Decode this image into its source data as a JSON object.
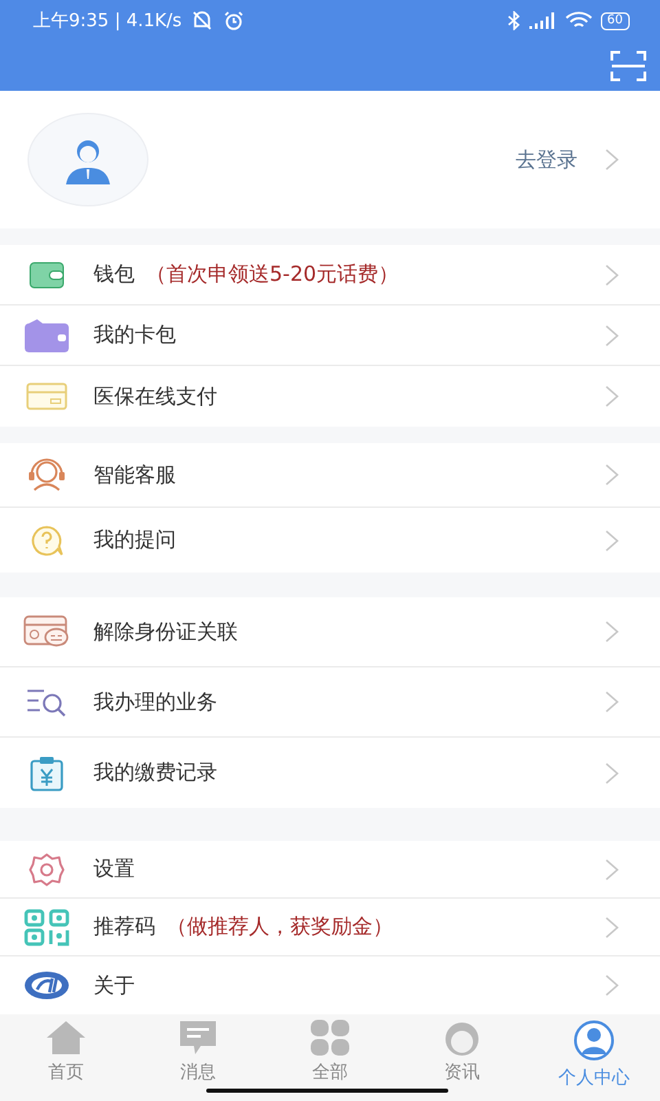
{
  "status_bar": {
    "time": "上午9:35 | 4.1K/s",
    "battery": "60"
  },
  "profile": {
    "login": "去登录"
  },
  "groups": [
    {
      "items": [
        {
          "kind": "wallet",
          "label": "钱包",
          "note": "（首次申领送5-20元话费）"
        },
        {
          "kind": "cardbag",
          "label": "我的卡包"
        },
        {
          "kind": "card",
          "label": "医保在线支付"
        }
      ]
    },
    {
      "items": [
        {
          "kind": "service",
          "label": "智能客服"
        },
        {
          "kind": "question",
          "label": "我的提问"
        }
      ]
    },
    {
      "items": [
        {
          "kind": "idcard",
          "label": "解除身份证关联"
        },
        {
          "kind": "search",
          "label": "我办理的业务"
        },
        {
          "kind": "bill",
          "label": "我的缴费记录"
        }
      ]
    },
    {
      "items": [
        {
          "kind": "gear",
          "label": "设置"
        },
        {
          "kind": "qr",
          "label": "推荐码",
          "note": "（做推荐人，获奖励金）"
        },
        {
          "kind": "logo",
          "label": "关于"
        }
      ]
    }
  ],
  "tabs": [
    {
      "kind": "home",
      "label": "首页",
      "selected": false
    },
    {
      "kind": "message",
      "label": "消息",
      "selected": false
    },
    {
      "kind": "grid",
      "label": "全部",
      "selected": false
    },
    {
      "kind": "news",
      "label": "资讯",
      "selected": false
    },
    {
      "kind": "person",
      "label": "个人中心",
      "selected": true
    }
  ]
}
